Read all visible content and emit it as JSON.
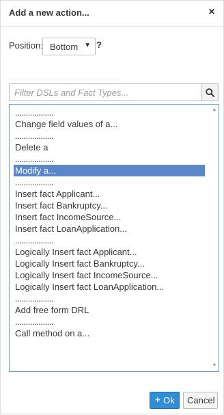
{
  "dialog": {
    "title": "Add a new action...",
    "close_label": "×"
  },
  "position": {
    "label": "Position:",
    "selected_value": "Bottom",
    "help_label": "?"
  },
  "search": {
    "placeholder": "Filter DSLs and Fact Types...",
    "value": ""
  },
  "list": {
    "items": [
      {
        "label": "..................",
        "kind": "separator"
      },
      {
        "label": "Change field values of a...",
        "kind": "option"
      },
      {
        "label": "..................",
        "kind": "separator"
      },
      {
        "label": "Delete a",
        "kind": "option"
      },
      {
        "label": "..................",
        "kind": "separator"
      },
      {
        "label": "Modify a...",
        "kind": "option",
        "selected": true
      },
      {
        "label": "..................",
        "kind": "separator"
      },
      {
        "label": "Insert fact Applicant...",
        "kind": "option"
      },
      {
        "label": "Insert fact Bankruptcy...",
        "kind": "option"
      },
      {
        "label": "Insert fact IncomeSource...",
        "kind": "option"
      },
      {
        "label": "Insert fact LoanApplication...",
        "kind": "option"
      },
      {
        "label": "..................",
        "kind": "separator"
      },
      {
        "label": "Logically Insert fact Applicant...",
        "kind": "option"
      },
      {
        "label": "Logically Insert fact Bankruptcy...",
        "kind": "option"
      },
      {
        "label": "Logically Insert fact IncomeSource...",
        "kind": "option"
      },
      {
        "label": "Logically Insert fact LoanApplication...",
        "kind": "option"
      },
      {
        "label": "..................",
        "kind": "separator"
      },
      {
        "label": "Add free form DRL",
        "kind": "option"
      },
      {
        "label": "..................",
        "kind": "separator"
      },
      {
        "label": "Call method on a...",
        "kind": "option"
      }
    ]
  },
  "footer": {
    "ok_icon": "+",
    "ok_label": "Ok",
    "cancel_label": "Cancel"
  },
  "colors": {
    "selection": "#5b87c9",
    "primary_button": "#2f8ed4",
    "listbox_border": "#5e9ed6"
  }
}
